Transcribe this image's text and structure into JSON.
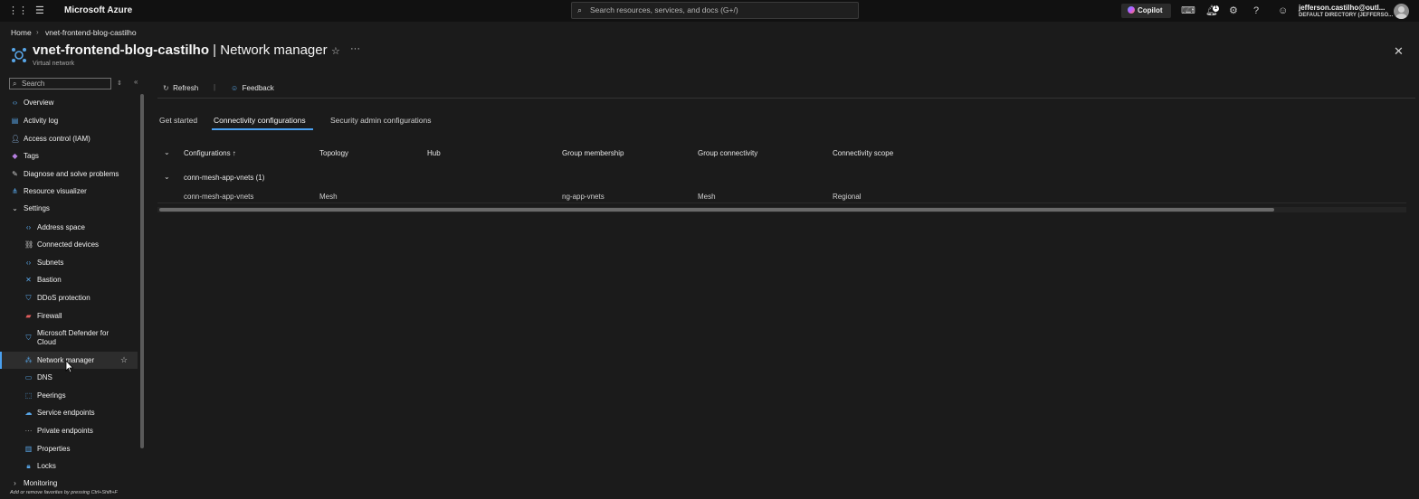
{
  "topbar": {
    "brand": "Microsoft Azure",
    "search_placeholder": "Search resources, services, and docs (G+/)",
    "copilot_label": "Copilot",
    "notification_count": "1",
    "user_email": "jefferson.castilho@outl...",
    "user_directory": "DEFAULT DIRECTORY (JEFFERSO..."
  },
  "breadcrumb": {
    "home": "Home",
    "separator": "›",
    "resource": "vnet-frontend-blog-castilho"
  },
  "header": {
    "title_resource": "vnet-frontend-blog-castilho",
    "title_section": " | Network manager",
    "subtitle": "Virtual network"
  },
  "sidebar": {
    "search_placeholder": "Search",
    "items": [
      {
        "label": "Overview",
        "icon": "overview-icon"
      },
      {
        "label": "Activity log",
        "icon": "activity-log-icon"
      },
      {
        "label": "Access control (IAM)",
        "icon": "iam-icon"
      },
      {
        "label": "Tags",
        "icon": "tag-icon"
      },
      {
        "label": "Diagnose and solve problems",
        "icon": "wrench-icon"
      },
      {
        "label": "Resource visualizer",
        "icon": "visualizer-icon"
      },
      {
        "label": "Settings",
        "icon": "chevron-down-icon"
      },
      {
        "label": "Address space",
        "icon": "address-space-icon"
      },
      {
        "label": "Connected devices",
        "icon": "connected-devices-icon"
      },
      {
        "label": "Subnets",
        "icon": "subnets-icon"
      },
      {
        "label": "Bastion",
        "icon": "bastion-icon"
      },
      {
        "label": "DDoS protection",
        "icon": "shield-icon"
      },
      {
        "label": "Firewall",
        "icon": "firewall-icon"
      },
      {
        "label": "Microsoft Defender for",
        "label2": "Cloud",
        "icon": "defender-icon"
      },
      {
        "label": "Network manager",
        "icon": "network-manager-icon"
      },
      {
        "label": "DNS",
        "icon": "dns-icon"
      },
      {
        "label": "Peerings",
        "icon": "peerings-icon"
      },
      {
        "label": "Service endpoints",
        "icon": "service-endpoints-icon"
      },
      {
        "label": "Private endpoints",
        "icon": "private-endpoints-icon"
      },
      {
        "label": "Properties",
        "icon": "properties-icon"
      },
      {
        "label": "Locks",
        "icon": "lock-icon"
      },
      {
        "label": "Monitoring",
        "icon": "chevron-right-icon"
      }
    ],
    "footer_hint": "Add or remove favorites by pressing Ctrl+Shift+F"
  },
  "commands": {
    "refresh": "Refresh",
    "feedback": "Feedback"
  },
  "tabs": [
    {
      "label": "Get started",
      "active": false
    },
    {
      "label": "Connectivity configurations",
      "active": true
    },
    {
      "label": "Security admin configurations",
      "active": false
    }
  ],
  "table": {
    "columns": [
      "Configurations ↑",
      "Topology",
      "Hub",
      "Group membership",
      "Group connectivity",
      "Connectivity scope"
    ],
    "group_label": "conn-mesh-app-vnets (1)",
    "rows": [
      [
        "conn-mesh-app-vnets",
        "Mesh",
        "",
        "ng-app-vnets",
        "Mesh",
        "Regional"
      ]
    ]
  },
  "colors": {
    "accent": "#4aa0f0",
    "background": "#1b1b1b",
    "topbar": "#111111"
  }
}
